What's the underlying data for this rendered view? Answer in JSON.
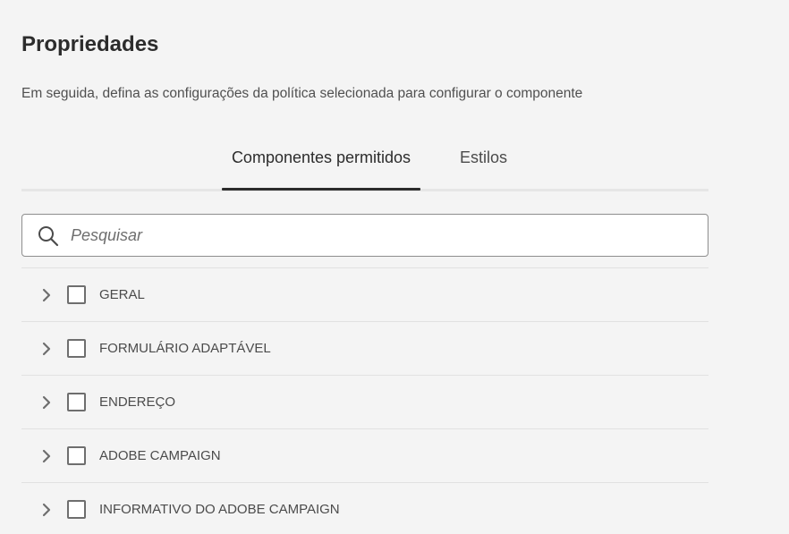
{
  "header": {
    "title": "Propriedades",
    "description": "Em seguida, defina as configurações da política selecionada para configurar o componente"
  },
  "tabs": [
    {
      "label": "Componentes permitidos",
      "selected": true
    },
    {
      "label": "Estilos",
      "selected": false
    }
  ],
  "search": {
    "placeholder": "Pesquisar",
    "value": ""
  },
  "groups": [
    {
      "label": "GERAL",
      "checked": false,
      "expanded": false
    },
    {
      "label": "FORMULÁRIO ADAPTÁVEL",
      "checked": false,
      "expanded": false
    },
    {
      "label": "ENDEREÇO",
      "checked": false,
      "expanded": false
    },
    {
      "label": "ADOBE CAMPAIGN",
      "checked": false,
      "expanded": false
    },
    {
      "label": "INFORMATIVO DO ADOBE CAMPAIGN",
      "checked": false,
      "expanded": false
    }
  ],
  "colors": {
    "background": "#f4f4f4",
    "text": "#2c2c2c",
    "tab_indicator": "#2c2c2c",
    "divider": "#e1e1e1"
  }
}
